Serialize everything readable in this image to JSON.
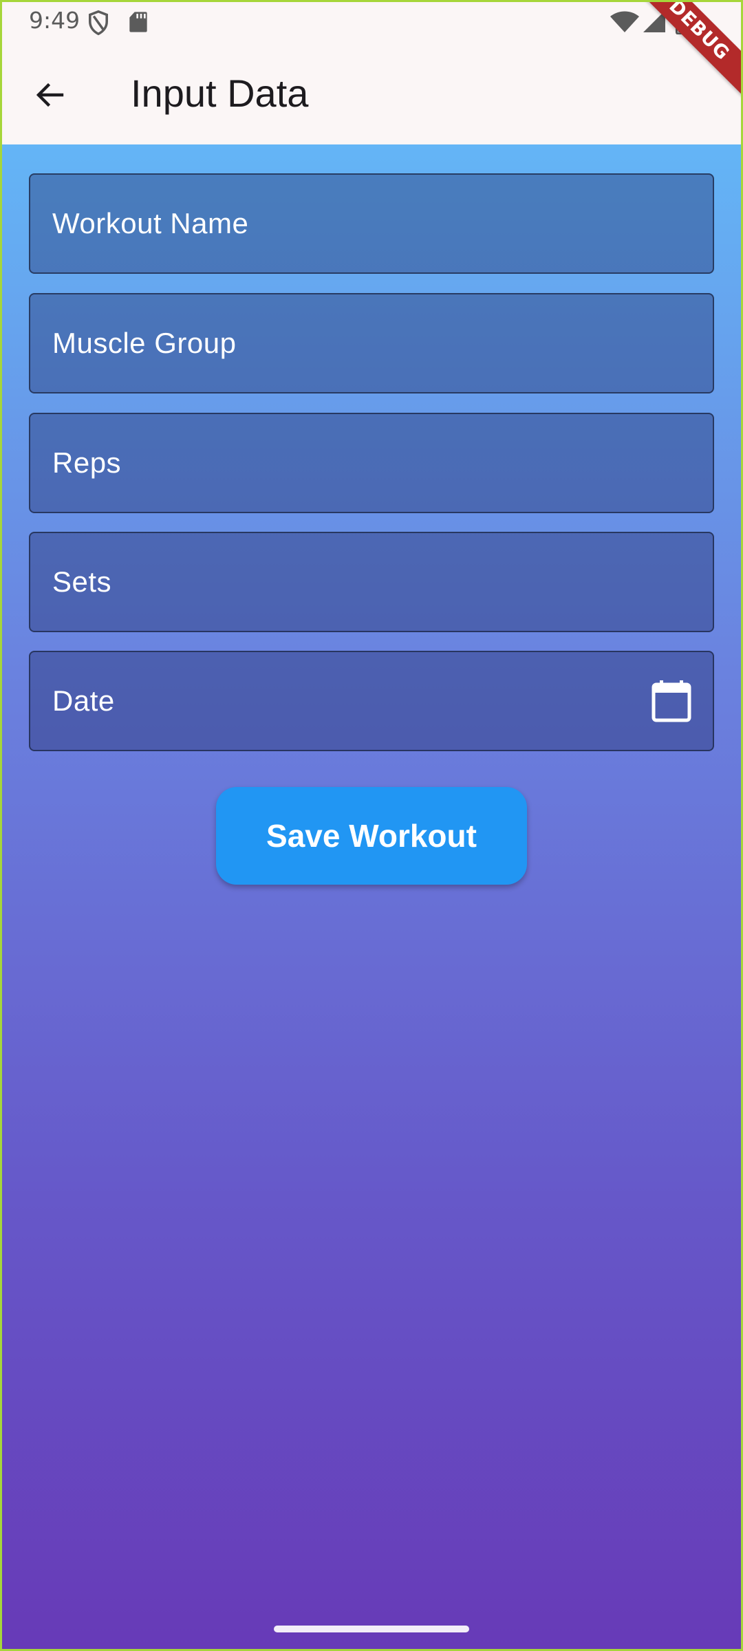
{
  "status_bar": {
    "time": "9:49",
    "icons": [
      "shield-icon",
      "sd-card-icon",
      "wifi-icon",
      "signal-icon",
      "battery-icon"
    ]
  },
  "debug_banner": {
    "label": "DEBUG",
    "color": "#b32a2a"
  },
  "app_bar": {
    "title": "Input Data",
    "back_icon": "arrow-back-icon"
  },
  "form": {
    "fields": [
      {
        "label": "Workout Name"
      },
      {
        "label": "Muscle Group"
      },
      {
        "label": "Reps"
      },
      {
        "label": "Sets"
      },
      {
        "label": "Date",
        "trailing_icon": "calendar-icon"
      }
    ],
    "save_label": "Save Workout"
  },
  "colors": {
    "gradient_top": "#64b5f6",
    "gradient_bottom": "#673ab7",
    "button": "#2196f3",
    "app_bar_bg": "#fbf6f6"
  }
}
